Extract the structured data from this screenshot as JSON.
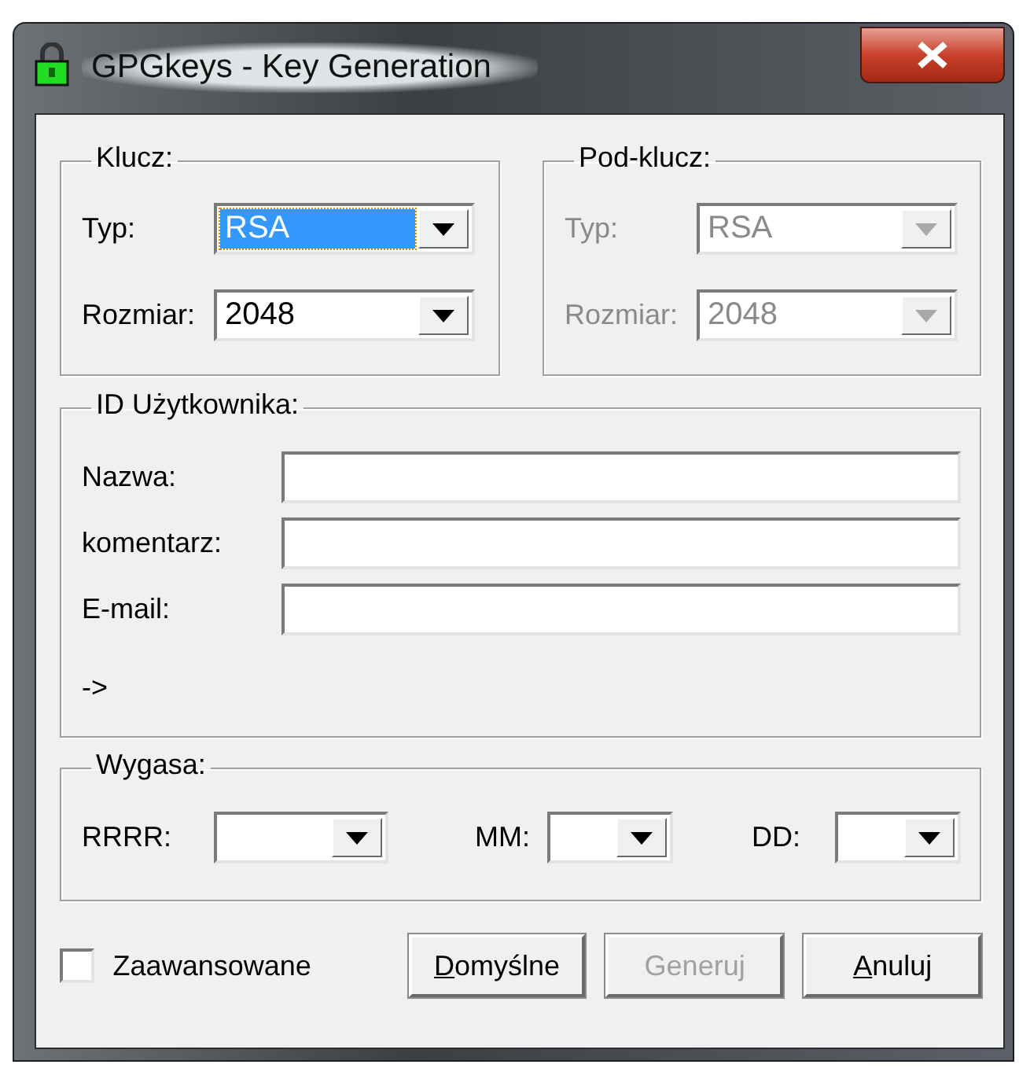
{
  "window": {
    "title": "GPGkeys - Key Generation"
  },
  "key_groups": [
    {
      "title": "Klucz:",
      "disabled": false,
      "fields": [
        {
          "label": "Typ:",
          "value": "RSA",
          "focused": true
        },
        {
          "label": "Rozmiar:",
          "value": "2048",
          "focused": false
        }
      ]
    },
    {
      "title": "Pod-klucz:",
      "disabled": true,
      "fields": [
        {
          "label": "Typ:",
          "value": "RSA",
          "focused": false
        },
        {
          "label": "Rozmiar:",
          "value": "2048",
          "focused": false
        }
      ]
    }
  ],
  "user_id": {
    "title": "ID Użytkownika:",
    "fields": [
      {
        "label": "Nazwa:"
      },
      {
        "label": "komentarz:"
      },
      {
        "label": "E-mail:"
      }
    ],
    "preview": "->"
  },
  "expiry": {
    "title": "Wygasa:",
    "fields": [
      {
        "label": "RRRR:"
      },
      {
        "label": "MM:"
      },
      {
        "label": "DD:"
      }
    ]
  },
  "advanced": {
    "label": "Zaawansowane",
    "checked": false
  },
  "buttons": [
    {
      "label": "Domyślne",
      "disabled": false,
      "mnemonic_underlined": true
    },
    {
      "label": "Generuj",
      "disabled": true,
      "mnemonic_underlined": false
    },
    {
      "label": "Anuluj",
      "disabled": false,
      "mnemonic_underlined": true
    }
  ]
}
